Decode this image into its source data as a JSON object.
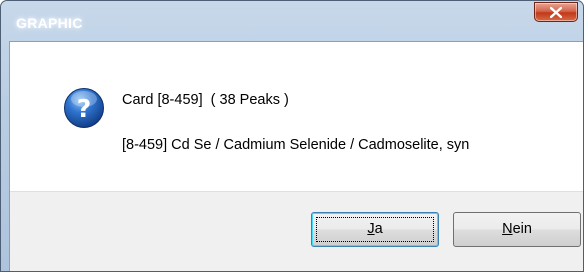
{
  "window": {
    "title": "GRAPHIC"
  },
  "dialog": {
    "icon": "question-icon",
    "message_line1": "Card [8-459]  ( 38 Peaks )",
    "message_line2": "[8-459] Cd Se / Cadmium Selenide / Cadmoselite, syn"
  },
  "buttons": {
    "yes": {
      "mnemonic": "J",
      "rest": "a"
    },
    "no": {
      "mnemonic": "N",
      "rest": "ein"
    }
  },
  "colors": {
    "close_button": "#c7452a",
    "icon_blue": "#1f5fb8",
    "button_bar": "#f0f0f0"
  }
}
